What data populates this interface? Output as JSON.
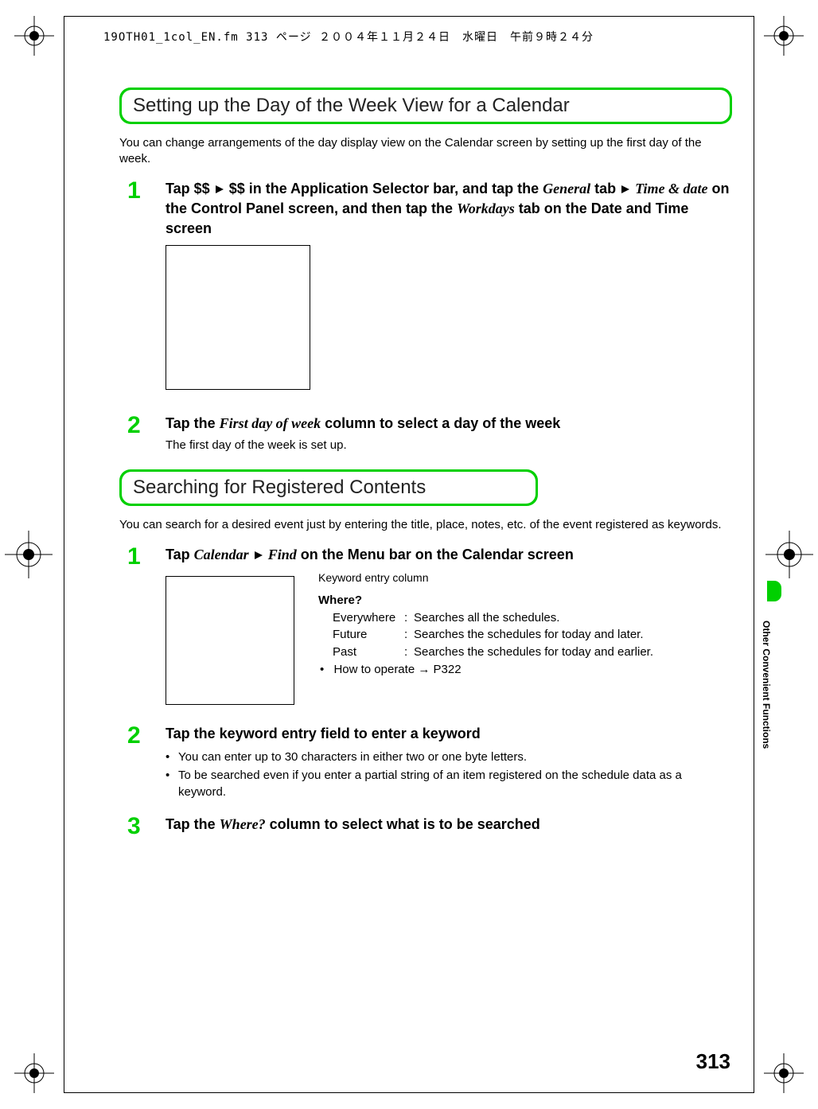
{
  "header": {
    "file_info": "19OTH01_1col_EN.fm  313 ページ  ２００４年１１月２４日　水曜日　午前９時２４分"
  },
  "sections": {
    "s1": {
      "heading": "Setting up the Day of the Week View for a Calendar",
      "intro": "You can change arrangements of the day display view on the Calendar screen by setting up the first day of the week.",
      "step1": {
        "num": "1",
        "part1": "Tap $$ ",
        "part2": " $$ in the Application Selector bar, and tap the ",
        "general": "General",
        "part3": " tab ",
        "timeDate": "Time & date",
        "part4": " on the Control Panel screen, and then tap the ",
        "workdays": "Workdays",
        "part5": " tab on the Date and Time screen"
      },
      "step2": {
        "num": "2",
        "pre": "Tap the ",
        "firstday": "First day of week",
        "post": " column to select a day of the week",
        "note": "The first day of the week is set up."
      }
    },
    "s2": {
      "heading": "Searching for Registered Contents",
      "intro": "You can search for a desired event just by entering the title, place, notes, etc. of the event registered as keywords.",
      "step1": {
        "num": "1",
        "pre": "Tap ",
        "calendar": "Calendar",
        "mid": " ",
        "find": "Find",
        "post": " on the Menu bar on the Calendar screen",
        "keyword_label": "Keyword entry column",
        "where_heading": "Where?",
        "rows": {
          "everywhere_k": "Everywhere",
          "everywhere_v": "Searches all the schedules.",
          "future_k": "Future",
          "future_v": "Searches the schedules for today and later.",
          "past_k": "Past",
          "past_v": "Searches the schedules for today and earlier."
        },
        "howto": "How to operate ",
        "pageref": " P322"
      },
      "step2": {
        "num": "2",
        "title": "Tap the keyword entry field to enter a keyword",
        "b1": "You can enter up to 30 characters in either two or one byte letters.",
        "b2": "To be searched even if you enter a partial string of an item registered on the schedule data as a keyword."
      },
      "step3": {
        "num": "3",
        "pre": "Tap the ",
        "where": "Where?",
        "post": " column to select what is to be searched"
      }
    }
  },
  "side": {
    "label": "Other Convenient Functions"
  },
  "page_number": "313"
}
